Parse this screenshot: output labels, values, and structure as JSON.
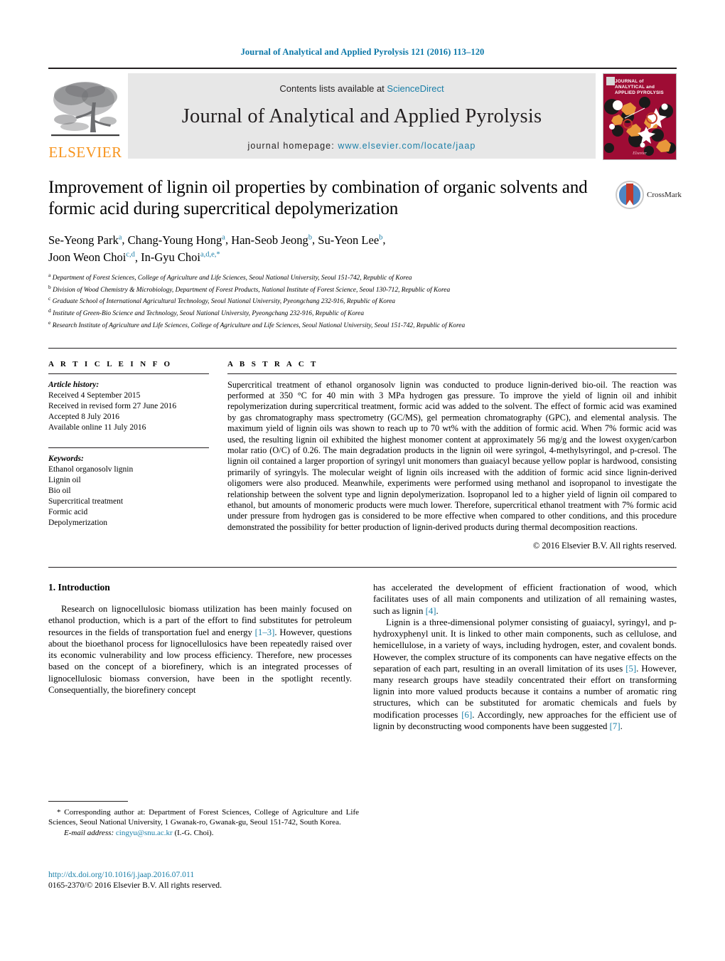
{
  "running_head": "Journal of Analytical and Applied Pyrolysis 121 (2016) 113–120",
  "masthead": {
    "contents_prefix": "Contents lists available at ",
    "sciencedirect": "ScienceDirect",
    "journal_title": "Journal of Analytical and Applied Pyrolysis",
    "homepage_prefix": "journal homepage: ",
    "homepage_url": "www.elsevier.com/locate/jaap",
    "publisher": "ELSEVIER",
    "cover_title": "JOURNAL of ANALYTICAL and APPLIED PYROLYSIS",
    "cover_publisher": "Elsevier",
    "accent_link": "#1b7fa8",
    "publisher_color": "#f7941d",
    "cover_bg": "#9e0c34"
  },
  "article": {
    "title": "Improvement of lignin oil properties by combination of organic solvents and formic acid during supercritical depolymerization",
    "crossmark_label": "CrossMark",
    "authors_line1_parts": [
      {
        "name": "Se-Yeong Park",
        "sup": "a"
      },
      {
        "name": "Chang-Young Hong",
        "sup": "a"
      },
      {
        "name": "Han-Seob Jeong",
        "sup": "b"
      },
      {
        "name": "Su-Yeon Lee",
        "sup": "b"
      }
    ],
    "authors_line2_parts": [
      {
        "name": "Joon Weon Choi",
        "sup": "c,d"
      },
      {
        "name": "In-Gyu Choi",
        "sup": "a,d,e,*"
      }
    ],
    "affiliations": [
      {
        "mark": "a",
        "text": "Department of Forest Sciences, College of Agriculture and Life Sciences, Seoul National University, Seoul 151-742, Republic of Korea"
      },
      {
        "mark": "b",
        "text": "Division of Wood Chemistry & Microbiology, Department of Forest Products, National Institute of Forest Science, Seoul 130-712, Republic of Korea"
      },
      {
        "mark": "c",
        "text": "Graduate School of International Agricultural Technology, Seoul National University, Pyeongchang 232-916, Republic of Korea"
      },
      {
        "mark": "d",
        "text": "Institute of Green-Bio Science and Technology, Seoul National University, Pyeongchang 232-916, Republic of Korea"
      },
      {
        "mark": "e",
        "text": "Research Institute of Agriculture and Life Sciences, College of Agriculture and Life Sciences, Seoul National University, Seoul 151-742, Republic of Korea"
      }
    ]
  },
  "article_info": {
    "heading": "A R T I C L E    I N F O",
    "history_label": "Article history:",
    "history": [
      "Received 4 September 2015",
      "Received in revised form 27 June 2016",
      "Accepted 8 July 2016",
      "Available online 11 July 2016"
    ],
    "keywords_label": "Keywords:",
    "keywords": [
      "Ethanol organosolv lignin",
      "Lignin oil",
      "Bio oil",
      "Supercritical treatment",
      "Formic acid",
      "Depolymerization"
    ]
  },
  "abstract": {
    "heading": "A B S T R A C T",
    "text": "Supercritical treatment of ethanol organosolv lignin was conducted to produce lignin-derived bio-oil. The reaction was performed at 350 °C for 40 min with 3 MPa hydrogen gas pressure. To improve the yield of lignin oil and inhibit repolymerization during supercritical treatment, formic acid was added to the solvent. The effect of formic acid was examined by gas chromatography mass spectrometry (GC/MS), gel permeation chromatography (GPC), and elemental analysis. The maximum yield of lignin oils was shown to reach up to 70 wt% with the addition of formic acid. When 7% formic acid was used, the resulting lignin oil exhibited the highest monomer content at approximately 56 mg/g and the lowest oxygen/carbon molar ratio (O/C) of 0.26. The main degradation products in the lignin oil were syringol, 4-methylsyringol, and p-cresol. The lignin oil contained a larger proportion of syringyl unit monomers than guaiacyl because yellow poplar is hardwood, consisting primarily of syringyls. The molecular weight of lignin oils increased with the addition of formic acid since lignin-derived oligomers were also produced. Meanwhile, experiments were performed using methanol and isopropanol to investigate the relationship between the solvent type and lignin depolymerization. Isopropanol led to a higher yield of lignin oil compared to ethanol, but amounts of monomeric products were much lower. Therefore, supercritical ethanol treatment with 7% formic acid under pressure from hydrogen gas is considered to be more effective when compared to other conditions, and this procedure demonstrated the possibility for better production of lignin-derived products during thermal decomposition reactions.",
    "copyright": "© 2016 Elsevier B.V. All rights reserved."
  },
  "introduction": {
    "heading": "1.  Introduction",
    "left_p1_a": "Research on lignocellulosic biomass utilization has been mainly focused on ethanol production, which is a part of the effort to find substitutes for petroleum resources in the fields of transportation fuel and energy ",
    "left_p1_ref": "[1–3]",
    "left_p1_b": ". However, questions about the bioethanol process for lignocellulosics have been repeatedly raised over its economic vulnerability and low process efficiency. Therefore, new processes based on the concept of a biorefinery, which is an integrated processes of lignocellulosic biomass conversion, have been in the spotlight recently. Consequentially, the biorefinery concept",
    "right_p1_cont_a": "has accelerated the development of efficient fractionation of wood, which facilitates uses of all main components and utilization of all remaining wastes, such as lignin ",
    "right_p1_ref": "[4]",
    "right_p1_cont_b": ".",
    "right_p2_a": "Lignin is a three-dimensional polymer consisting of guaiacyl, syringyl, and p-hydroxyphenyl unit. It is linked to other main components, such as cellulose, and hemicellulose, in a variety of ways, including hydrogen, ester, and covalent bonds. However, the complex structure of its components can have negative effects on the separation of each part, resulting in an overall limitation of its uses ",
    "right_p2_ref1": "[5]",
    "right_p2_b": ". However, many research groups have steadily concentrated their effort on transforming lignin into more valued products because it contains a number of aromatic ring structures, which can be substituted for aromatic chemicals and fuels by modification processes ",
    "right_p2_ref2": "[6]",
    "right_p2_c": ". Accordingly, new approaches for the efficient use of lignin by deconstructing wood components have been suggested ",
    "right_p2_ref3": "[7]",
    "right_p2_d": "."
  },
  "footnote": {
    "corresponding": "* Corresponding author at: Department of Forest Sciences, College of Agriculture and Life Sciences, Seoul National University, 1 Gwanak-ro, Gwanak-gu, Seoul 151-742, South Korea.",
    "email_label": "E-mail address:",
    "email": "cingyu@snu.ac.kr",
    "email_suffix": "(I.-G. Choi)."
  },
  "footer": {
    "doi": "http://dx.doi.org/10.1016/j.jaap.2016.07.011",
    "issn_line": "0165-2370/© 2016 Elsevier B.V. All rights reserved."
  }
}
